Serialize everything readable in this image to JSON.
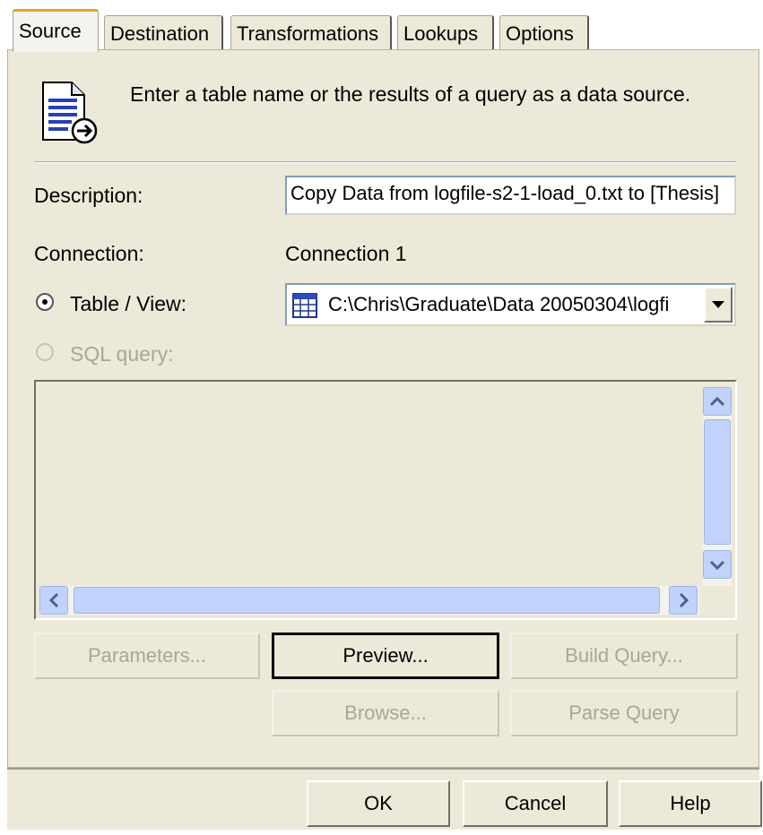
{
  "tabs": [
    "Source",
    "Destination",
    "Transformations",
    "Lookups",
    "Options"
  ],
  "header_text": "Enter a table name or the results of a query as a data source.",
  "header_icon": "document-arrow-icon",
  "description": {
    "label": "Description:",
    "value": "Copy Data from logfile-s2-1-load_0.txt to [Thesis]"
  },
  "connection": {
    "label": "Connection:",
    "value": "Connection 1"
  },
  "table_view": {
    "label": "Table / View:",
    "selected": true,
    "value": "C:\\Chris\\Graduate\\Data 20050304\\logfi"
  },
  "sql_query": {
    "label": "SQL query:",
    "selected": false,
    "enabled": false
  },
  "buttons": {
    "parameters": "Parameters...",
    "preview": "Preview...",
    "build_query": "Build Query...",
    "browse": "Browse...",
    "parse_query": "Parse Query",
    "ok": "OK",
    "cancel": "Cancel",
    "help": "Help"
  },
  "colors": {
    "dialog_bg": "#ece9d8",
    "active_tab_accent": "#e8a22d",
    "scrollbar": "#c1d3fb"
  }
}
